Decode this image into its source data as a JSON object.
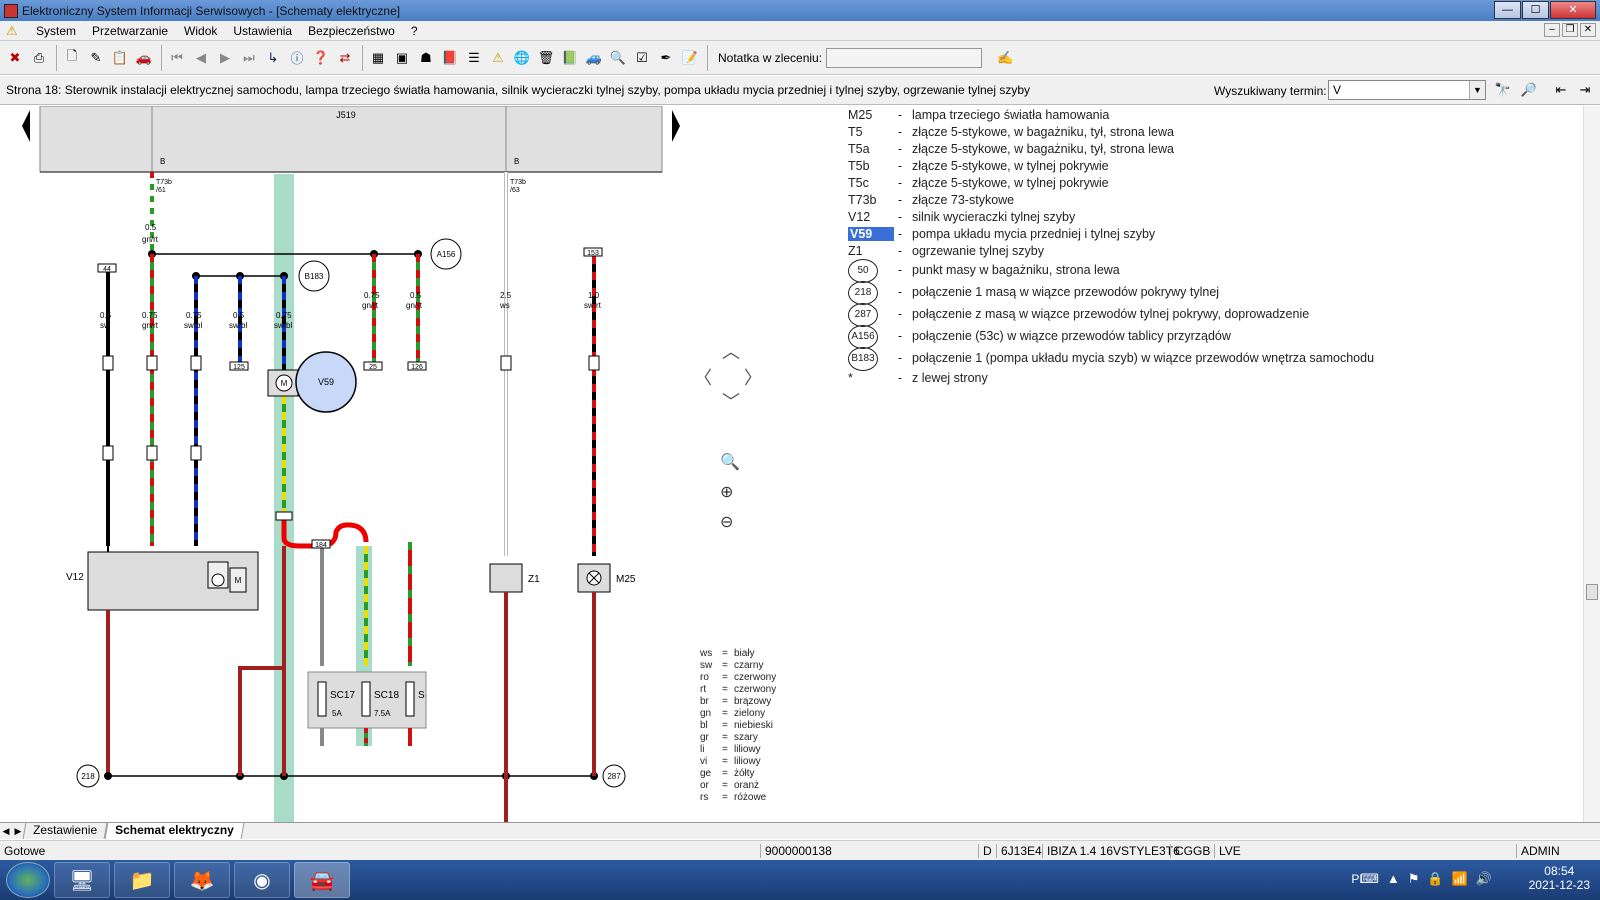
{
  "window": {
    "title": "Elektroniczny System Informacji Serwisowych - [Schematy elektryczne]",
    "controls": {
      "minimize": "—",
      "maximize": "☐",
      "close": "✕"
    }
  },
  "menu": {
    "items": [
      "System",
      "Przetwarzanie",
      "Widok",
      "Ustawienia",
      "Bezpieczeństwo",
      "?"
    ],
    "mdi_controls": [
      "–",
      "❐",
      "✕"
    ]
  },
  "toolbar": {
    "note_label": "Notatka w zleceniu:",
    "note_value": ""
  },
  "page": {
    "title": "Strona 18: Sterownik instalacji elektrycznej samochodu, lampa trzeciego światła hamowania, silnik wycieraczki tylnej szyby, pompa układu mycia przedniej i tylnej szyby, ogrzewanie tylnej szyby",
    "search_label": "Wyszukiwany termin:",
    "search_value": "V"
  },
  "diagram": {
    "control_unit": "J519",
    "pin_b_left": "B",
    "pin_b_right": "B",
    "conn_left": "T73b\n/61",
    "conn_right": "T73b\n/63",
    "motor_label": "V59",
    "wiper_label": "V12",
    "heater_label": "Z1",
    "lamp_label": "M25",
    "fuse1": "SC17",
    "fuse1_amp": "5A",
    "fuse2": "SC18",
    "fuse2_amp": "7.5A",
    "fuse3": "S",
    "ground_left": "218",
    "ground_right": "287",
    "node_a156": "A156",
    "node_b183": "B183",
    "wire_labels": [
      {
        "text": "0.5",
        "sub": "gn/rt"
      },
      {
        "text": "0.5",
        "sub": "sw"
      },
      {
        "text": "0.75",
        "sub": "gn/rt"
      },
      {
        "text": "0.75",
        "sub": "sw/bl"
      },
      {
        "text": "0.5",
        "sub": "sw/bl"
      },
      {
        "text": "0.75",
        "sub": "sw/bl"
      },
      {
        "text": "0.75",
        "sub": "gn/rt"
      },
      {
        "text": "0.5",
        "sub": "gn/rt"
      },
      {
        "text": "2.5",
        "sub": "ws"
      },
      {
        "text": "1.0",
        "sub": "sw/rt"
      }
    ],
    "terminals": [
      "44",
      "125",
      "25",
      "126",
      "153",
      "184"
    ]
  },
  "legend": [
    {
      "code": "M25",
      "desc": "lampa trzeciego światła hamowania"
    },
    {
      "code": "T5",
      "desc": "złącze 5-stykowe, w bagażniku, tył, strona lewa"
    },
    {
      "code": "T5a",
      "desc": "złącze 5-stykowe, w bagażniku, tył, strona lewa"
    },
    {
      "code": "T5b",
      "desc": "złącze 5-stykowe, w tylnej pokrywie"
    },
    {
      "code": "T5c",
      "desc": "złącze 5-stykowe, w tylnej pokrywie"
    },
    {
      "code": "T73b",
      "desc": "złącze 73-stykowe"
    },
    {
      "code": "V12",
      "desc": "silnik wycieraczki tylnej szyby"
    },
    {
      "code": "V59",
      "desc": "pompa układu mycia przedniej i tylnej szyby",
      "highlight": true
    },
    {
      "code": "Z1",
      "desc": "ogrzewanie tylnej szyby"
    },
    {
      "code": "50",
      "desc": "punkt masy w bagażniku, strona lewa",
      "circle": true
    },
    {
      "code": "218",
      "desc": "połączenie 1 masą w wiązce przewodów pokrywy tylnej",
      "circle": true
    },
    {
      "code": "287",
      "desc": "połączenie z masą w wiązce przewodów tylnej pokrywy, doprowadzenie",
      "circle": true
    },
    {
      "code": "A156",
      "desc": "połączenie (53c) w wiązce przewodów tablicy przyrządów",
      "circle": true
    },
    {
      "code": "B183",
      "desc": "połączenie 1 (pompa układu mycia szyb) w wiązce przewodów wnętrza samochodu",
      "circle": true
    },
    {
      "code": "*",
      "desc": "z lewej strony"
    }
  ],
  "color_key": [
    {
      "abbr": "ws",
      "name": "biały"
    },
    {
      "abbr": "sw",
      "name": "czarny"
    },
    {
      "abbr": "ro",
      "name": "czerwony"
    },
    {
      "abbr": "rt",
      "name": "czerwony"
    },
    {
      "abbr": "br",
      "name": "brązowy"
    },
    {
      "abbr": "gn",
      "name": "zielony"
    },
    {
      "abbr": "bl",
      "name": "niebieski"
    },
    {
      "abbr": "gr",
      "name": "szary"
    },
    {
      "abbr": "li",
      "name": "liliowy"
    },
    {
      "abbr": "vi",
      "name": "liliowy"
    },
    {
      "abbr": "ge",
      "name": "żółty"
    },
    {
      "abbr": "or",
      "name": "oranż"
    },
    {
      "abbr": "rs",
      "name": "różowe"
    }
  ],
  "tabs": [
    {
      "label": "Zestawienie",
      "active": false
    },
    {
      "label": "Schemat elektryczny",
      "active": true
    }
  ],
  "status": {
    "state": "Gotowe",
    "order": "9000000138",
    "mode": "D",
    "engine": "6J13E4",
    "model": "IBIZA 1.4 16VSTYLE3T6",
    "code": "CGGB",
    "gear": "LVE",
    "user": "ADMIN"
  },
  "taskbar": {
    "lang": "PL",
    "time": "08:54",
    "date": "2021-12-23"
  },
  "colors": {
    "accent": "#3a6fd8",
    "wire_red": "#d01010",
    "wire_green": "#2a9a2a",
    "wire_blue": "#1030c0",
    "wire_brown": "#a02020",
    "highlight_bg": "#a8dcc8"
  }
}
